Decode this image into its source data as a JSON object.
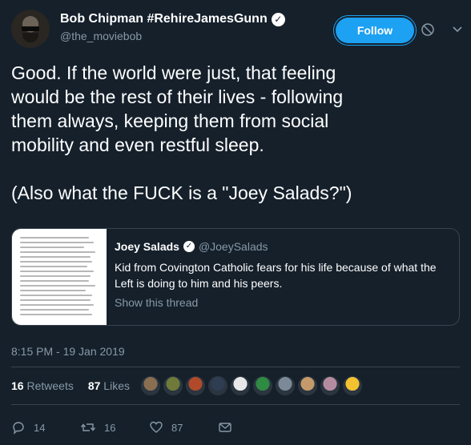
{
  "author": {
    "name": "Bob Chipman #RehireJamesGunn",
    "handle": "@the_moviebob",
    "verified_glyph": "✓"
  },
  "follow_label": "Follow",
  "tweet": {
    "line1": "Good. If the world were just, that feeling",
    "line2": "would be the rest of their lives - following",
    "line3": "them always, keeping them from social",
    "line4": "mobility and even restful sleep.",
    "line5": "(Also what the FUCK is a \"Joey Salads?\")"
  },
  "quote": {
    "name": "Joey Salads",
    "handle": "@JoeySalads",
    "text_line1": "Kid from Covington Catholic fears for his life because of what the",
    "text_line2": "Left is doing to him and his peers.",
    "show_thread": "Show this thread"
  },
  "timestamp": "8:15 PM - 19 Jan 2019",
  "stats": {
    "retweets_count": "16",
    "retweets_label": "Retweets",
    "likes_count": "87",
    "likes_label": "Likes"
  },
  "actions": {
    "reply_count": "14",
    "retweet_count": "16",
    "like_count": "87"
  },
  "colors": {
    "background": "#15202b",
    "accent": "#1da1f2",
    "secondary_text": "#8899a6",
    "border": "#38444d"
  },
  "liker_colors": [
    "#8a6e52",
    "#6f7a3a",
    "#b04a2a",
    "#2f3d52",
    "#e8e8e8",
    "#2f8a44",
    "#7b8a96",
    "#c59a6a",
    "#b58ba0",
    "#f2c230"
  ]
}
